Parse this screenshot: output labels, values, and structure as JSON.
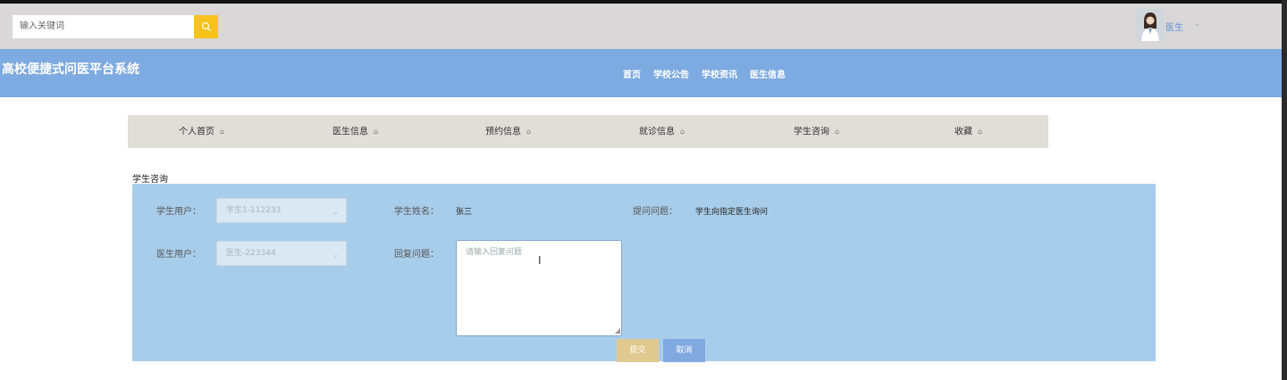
{
  "topbar": {
    "search_placeholder": "输入关键词",
    "search_icon": "search-icon",
    "user_name": "医生",
    "user_caret": "⌄"
  },
  "header": {
    "brand": "高校便捷式问医平台系统",
    "nav": [
      "首页",
      "学校公告",
      "学校资讯",
      "医生信息"
    ]
  },
  "tabs": [
    {
      "label": "个人首页",
      "icon": "home-icon"
    },
    {
      "label": "医生信息",
      "icon": "home-icon"
    },
    {
      "label": "预约信息",
      "icon": "home-icon"
    },
    {
      "label": "就诊信息",
      "icon": "home-icon"
    },
    {
      "label": "学生咨询",
      "icon": "home-icon"
    },
    {
      "label": "收藏",
      "icon": "home-icon"
    }
  ],
  "form": {
    "section_title": "学生咨询",
    "student_user_label": "学生用户：",
    "student_user_value": "学生1-112233",
    "student_name_label": "学生姓名：",
    "student_name_value": "张三",
    "question_label": "提问问题：",
    "question_value": "学生向指定医生询问",
    "doctor_user_label": "医生用户：",
    "doctor_user_value": "医生-223344",
    "reply_label": "回复问题：",
    "reply_placeholder": "请输入回复问题",
    "submit_label": "提交",
    "cancel_label": "取消"
  },
  "colors": {
    "header_bg": "#7daae0",
    "panel_bg": "#a8cdea",
    "search_button": "#f6c21c",
    "submit_button": "#e0c98e",
    "cancel_button": "#81a9e0"
  }
}
